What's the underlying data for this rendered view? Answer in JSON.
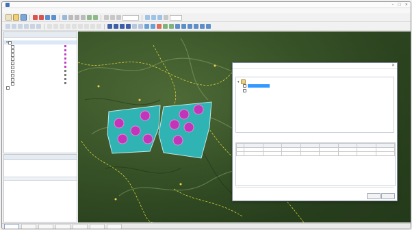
{
  "window": {
    "title": ""
  },
  "menubar": {
    "items": [
      "",
      "",
      "",
      "",
      "",
      "",
      "",
      "",
      "",
      "",
      "",
      ""
    ]
  },
  "toolbar": {
    "zoom_value": "",
    "scale_value": ""
  },
  "layers_panel": {
    "title": "",
    "root_label": "",
    "items": [
      {
        "label": "",
        "value": ""
      },
      {
        "label": "",
        "value": ""
      },
      {
        "label": "",
        "value": ""
      },
      {
        "label": "",
        "value": ""
      },
      {
        "label": "",
        "value": ""
      },
      {
        "label": "",
        "value": ""
      },
      {
        "label": "",
        "value": ""
      },
      {
        "label": "",
        "value": ""
      },
      {
        "label": "",
        "value": ""
      },
      {
        "label": "",
        "value": ""
      }
    ],
    "bottom_item": ""
  },
  "props_panel": {
    "title": "",
    "row_label": "",
    "tabs": [
      "",
      "",
      ""
    ]
  },
  "statusbar": {
    "tabs": [
      "",
      "",
      "",
      "",
      "",
      "",
      ""
    ],
    "text": ""
  },
  "dialog": {
    "title": "",
    "group_label": "",
    "tree": {
      "root": "",
      "selected_item": "",
      "other_item": ""
    },
    "table_label": "",
    "table": {
      "headers": [
        "",
        "",
        "",
        "",
        "",
        "",
        "",
        "",
        ""
      ],
      "rows": [
        [
          "",
          "",
          "",
          "",
          "",
          "",
          "",
          "",
          ""
        ],
        [
          "",
          "",
          "",
          "",
          "",
          "",
          "",
          "",
          ""
        ]
      ]
    },
    "hint_text": "",
    "ok_label": "",
    "cancel_label": ""
  },
  "map": {
    "markers": [
      "",
      "",
      "",
      "",
      "",
      ""
    ],
    "polygon_fill": "#2fb3b3",
    "circle_fill": "#c234b8"
  },
  "colors": {
    "accent": "#3f73b5",
    "selection": "#3399ff"
  }
}
